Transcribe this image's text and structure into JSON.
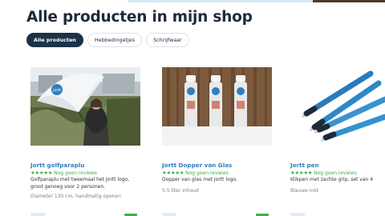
{
  "page": {
    "title": "Alle producten in mijn shop",
    "accent_color": "#3fae49",
    "link_color": "#2f7fc0",
    "active_tab_color": "#1b3348"
  },
  "tabs": [
    {
      "label": "Alle producten",
      "active": true
    },
    {
      "label": "Hebbedingetjes",
      "active": false
    },
    {
      "label": "Schrijfwaar",
      "active": false
    }
  ],
  "products": [
    {
      "name": "Jortt golfparaplu",
      "stars": "★★★★★",
      "reviews": "Nog geen reviews",
      "description": "Golfparaplu met tweemaal het Jortt logo, groot genoeg voor 2 personen.",
      "spec": "Diameter 130 cm, handmatig openen",
      "image_icon": "umbrella-photo",
      "umbrella_text": "Jortt"
    },
    {
      "name": "Jortt Dopper van Glas",
      "stars": "★★★★★",
      "reviews": "Nog geen reviews",
      "description": "Dopper van glas met Jortt logo.",
      "spec": "0,5 liter inhoud",
      "image_icon": "bottles-photo"
    },
    {
      "name": "Jortt pen",
      "stars": "★★★★★",
      "reviews": "Nog geen reviews",
      "description": "Klikpen met zachte grip, set van 4",
      "spec": "Blauwe inkt",
      "image_icon": "pens-photo"
    }
  ]
}
